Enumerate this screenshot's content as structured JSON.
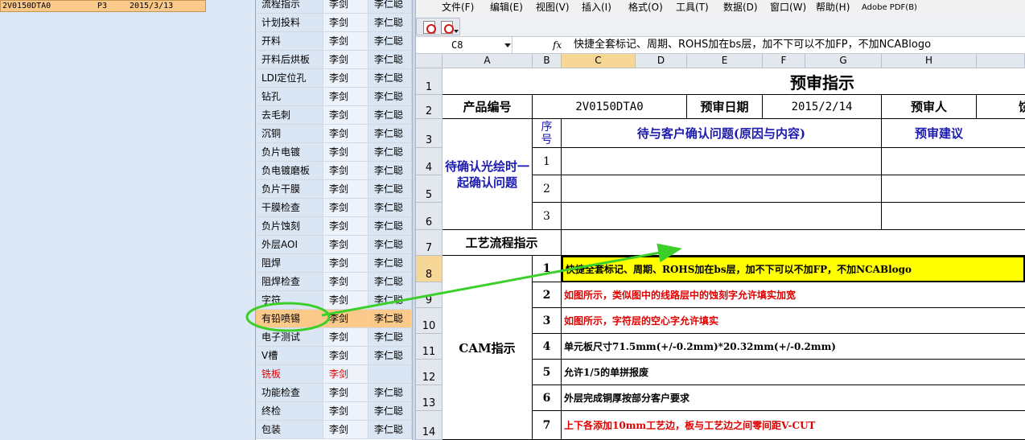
{
  "order_list": {
    "row": {
      "code": "2V0150DTA0",
      "rev": "P3",
      "date": "2015/3/13"
    }
  },
  "process_list": {
    "rows": [
      {
        "step": "流程指示",
        "person1": "李剑",
        "person2": "李仁聪"
      },
      {
        "step": "计划投料",
        "person1": "李剑",
        "person2": "李仁聪"
      },
      {
        "step": "开料",
        "person1": "李剑",
        "person2": "李仁聪"
      },
      {
        "step": "开料后烘板",
        "person1": "李剑",
        "person2": "李仁聪"
      },
      {
        "step": "LDI定位孔",
        "person1": "李剑",
        "person2": "李仁聪"
      },
      {
        "step": "钻孔",
        "person1": "李剑",
        "person2": "李仁聪"
      },
      {
        "step": "去毛刺",
        "person1": "李剑",
        "person2": "李仁聪"
      },
      {
        "step": "沉铜",
        "person1": "李剑",
        "person2": "李仁聪"
      },
      {
        "step": "负片电镀",
        "person1": "李剑",
        "person2": "李仁聪"
      },
      {
        "step": "负电镀磨板",
        "person1": "李剑",
        "person2": "李仁聪"
      },
      {
        "step": "负片干膜",
        "person1": "李剑",
        "person2": "李仁聪"
      },
      {
        "step": "干膜检查",
        "person1": "李剑",
        "person2": "李仁聪"
      },
      {
        "step": "负片蚀刻",
        "person1": "李剑",
        "person2": "李仁聪"
      },
      {
        "step": "外层AOI",
        "person1": "李剑",
        "person2": "李仁聪"
      },
      {
        "step": "阻焊",
        "person1": "李剑",
        "person2": "李仁聪"
      },
      {
        "step": "阻焊检查",
        "person1": "李剑",
        "person2": "李仁聪"
      },
      {
        "step": "字符",
        "person1": "李剑",
        "person2": "李仁聪"
      },
      {
        "step": "有铅喷锡",
        "person1": "李剑",
        "person2": "李仁聪"
      },
      {
        "step": "电子测试",
        "person1": "李剑",
        "person2": "李仁聪"
      },
      {
        "step": "V槽",
        "person1": "李剑",
        "person2": "李仁聪"
      },
      {
        "step": "铣板",
        "person1": "李剑",
        "person2": ""
      },
      {
        "step": "功能检查",
        "person1": "李剑",
        "person2": "李仁聪"
      },
      {
        "step": "终检",
        "person1": "李剑",
        "person2": "李仁聪"
      },
      {
        "step": "包装",
        "person1": "李剑",
        "person2": "李仁聪"
      }
    ],
    "selected_index": 17,
    "red_index": 20
  },
  "menu": {
    "items": [
      "文件(F)",
      "编辑(E)",
      "视图(V)",
      "插入(I)",
      "格式(O)",
      "工具(T)",
      "数据(D)",
      "窗口(W)",
      "帮助(H)",
      "Adobe PDF(B)"
    ]
  },
  "toolbar": {
    "icons": [
      "pdf-convert-icon",
      "pdf-email-icon",
      "toolbar-options-icon"
    ]
  },
  "formula_bar": {
    "cell_ref": "C8",
    "fx_label": "fx",
    "content": "快捷全套标记、周期、ROHS加在bs层，加不下可以不加FP，不加NCABlogo"
  },
  "columns": [
    "A",
    "B",
    "C",
    "D",
    "E",
    "F",
    "G",
    "H",
    ""
  ],
  "row_numbers": [
    "1",
    "2",
    "3",
    "4",
    "5",
    "6",
    "7",
    "8",
    "9",
    "10",
    "11",
    "12",
    "13",
    "14"
  ],
  "selection": {
    "column": "C",
    "row": "8"
  },
  "sheet": {
    "title": "预审指示",
    "product_no_label": "产品编号",
    "product_no": "2V0150DTA0",
    "review_date_label": "预审日期",
    "review_date": "2015/2/14",
    "reviewer_label": "预审人",
    "reviewer_value_partial": "饶",
    "pending_label": "待确认光绘时一起确认问题",
    "seq_label": "序号",
    "issue_header": "待与客户确认问题(原因与内容)",
    "suggestion_header": "预审建议",
    "pending_numbers": [
      "1",
      "2",
      "3"
    ],
    "process_label": "工艺流程指示",
    "cam_label": "CAM指示",
    "cam_items": [
      {
        "no": "1",
        "text": "快捷全套标记、周期、ROHS加在bs层，加不下可以不加FP，不加NCABlogo",
        "color": "#000000",
        "highlight": "#ffff00"
      },
      {
        "no": "2",
        "text": "如图所示，类似图中的线路层中的蚀刻字允许填实加宽",
        "color": "#e00000"
      },
      {
        "no": "3",
        "text": "如图所示，字符层的空心字允许填实",
        "color": "#e00000"
      },
      {
        "no": "4",
        "text": "单元板尺寸71.5mm(+/-0.2mm)*20.32mm(+/-0.2mm)",
        "color": "#000000"
      },
      {
        "no": "5",
        "text": "允许1/5的单拼报废",
        "color": "#000000"
      },
      {
        "no": "6",
        "text": "外层完成铜厚按部分客户要求",
        "color": "#000000"
      },
      {
        "no": "7",
        "text": "上下各添加10mm工艺边，板与工艺边之间零间距V-CUT",
        "color": "#e00000"
      }
    ]
  },
  "annotation": {
    "color": "#3ccf2a",
    "shape": "ellipse-with-arrow"
  }
}
